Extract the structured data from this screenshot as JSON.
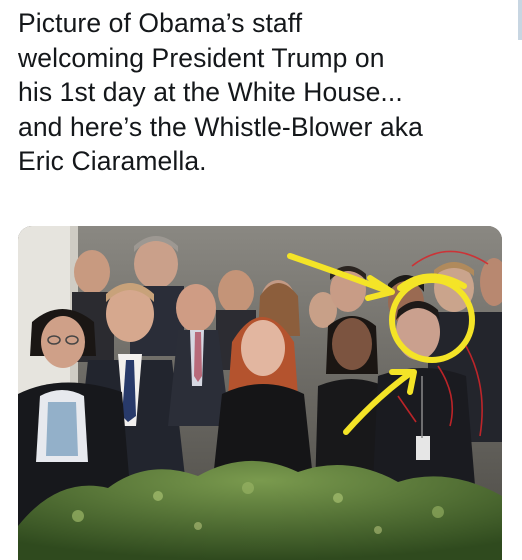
{
  "post": {
    "text": "Picture of Obama’s staff\nwelcoming President Trump on\nhis 1st day at the White House...\nand here’s the Whistle-Blower aka\nEric Ciaramella."
  },
  "photo": {
    "subject": "group-photo",
    "annotation_color": "#f4e427",
    "sketch_color": "#d8262a",
    "icons": [
      "yellow-arrow-icon",
      "yellow-circle-icon"
    ]
  }
}
